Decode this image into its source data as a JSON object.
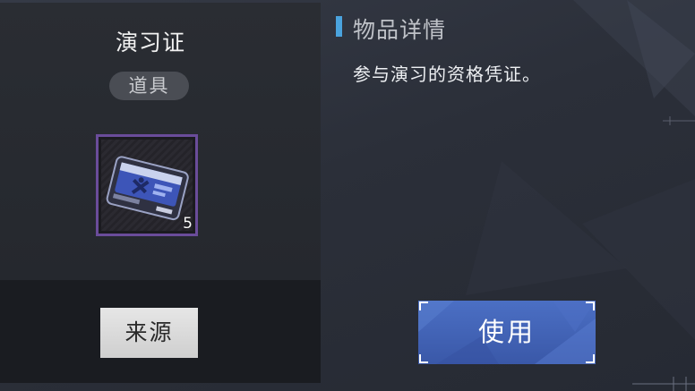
{
  "item": {
    "name": "演习证",
    "type_label": "道具",
    "count": "5",
    "icon": "exercise-pass-card-icon",
    "rarity_color": "#6a4c9a"
  },
  "detail": {
    "title": "物品详情",
    "description": "参与演习的资格凭证。",
    "accent_color": "#4aa3de"
  },
  "buttons": {
    "source_label": "来源",
    "use_label": "使用",
    "use_color": "#4565b8"
  }
}
